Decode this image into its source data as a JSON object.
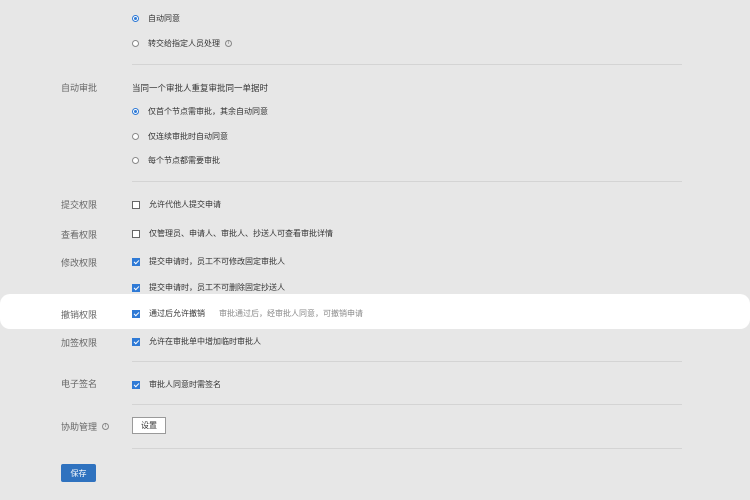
{
  "top_options": {
    "opt1": "自动同意",
    "opt2": "转交给指定人员处理"
  },
  "auto_approve": {
    "label": "自动审批",
    "heading": "当同一个审批人重复审批同一单据时",
    "opt1": "仅首个节点需审批，其余自动同意",
    "opt2": "仅连续审批时自动同意",
    "opt3": "每个节点都需要审批"
  },
  "submit_perm": {
    "label": "提交权限",
    "opt": "允许代他人提交申请"
  },
  "view_perm": {
    "label": "查看权限",
    "opt": "仅管理员、申请人、审批人、抄送人可查看审批详情"
  },
  "modify_perm": {
    "label": "修改权限",
    "opt1": "提交申请时，员工不可修改固定审批人",
    "opt2": "提交申请时，员工不可删除固定抄送人"
  },
  "revoke_perm": {
    "label": "撤销权限",
    "opt": "通过后允许撤销",
    "desc": "审批通过后，经审批人同意，可撤销申请"
  },
  "countersign_perm": {
    "label": "加签权限",
    "opt": "允许在审批单中增加临时审批人"
  },
  "e_signature": {
    "label": "电子签名",
    "opt": "审批人同意时需签名"
  },
  "assist_mgmt": {
    "label": "协助管理",
    "button": "设置"
  },
  "footer": {
    "save": "保存"
  },
  "colors": {
    "accent": "#2f7ad6",
    "save_button": "#2f72bf",
    "background": "#e7e7e7"
  }
}
